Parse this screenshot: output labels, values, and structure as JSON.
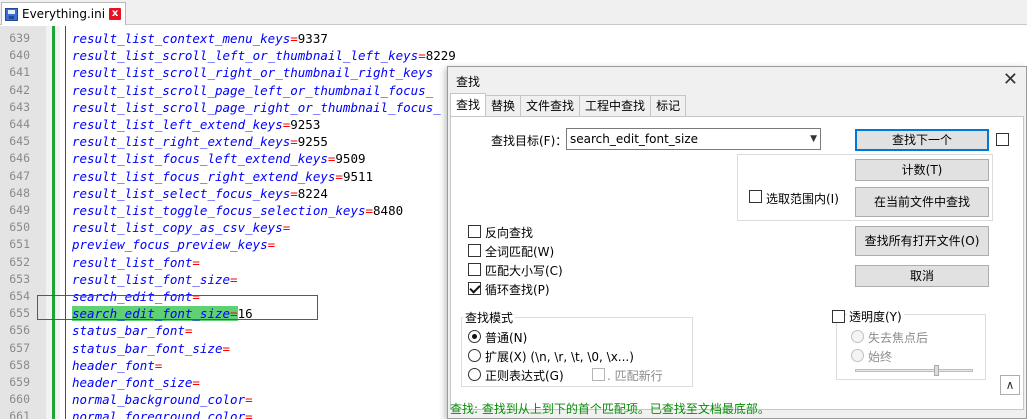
{
  "tab": {
    "label": "Everything.ini",
    "close": "x"
  },
  "editor": {
    "lines": [
      {
        "num": "639",
        "key": "result_list_context_menu_keys",
        "eq": "=",
        "val": "9337"
      },
      {
        "num": "640",
        "key": "result_list_scroll_left_or_thumbnail_left_keys",
        "eq": "=",
        "val": "8229"
      },
      {
        "num": "641",
        "key": "result_list_scroll_right_or_thumbnail_right_keys",
        "eq": "",
        "val": ""
      },
      {
        "num": "642",
        "key": "result_list_scroll_page_left_or_thumbnail_focus_",
        "eq": "",
        "val": ""
      },
      {
        "num": "643",
        "key": "result_list_scroll_page_right_or_thumbnail_focus_",
        "eq": "",
        "val": ""
      },
      {
        "num": "644",
        "key": "result_list_left_extend_keys",
        "eq": "=",
        "val": "9253"
      },
      {
        "num": "645",
        "key": "result_list_right_extend_keys",
        "eq": "=",
        "val": "9255"
      },
      {
        "num": "646",
        "key": "result_list_focus_left_extend_keys",
        "eq": "=",
        "val": "9509"
      },
      {
        "num": "647",
        "key": "result_list_focus_right_extend_keys",
        "eq": "=",
        "val": "9511"
      },
      {
        "num": "648",
        "key": "result_list_select_focus_keys",
        "eq": "=",
        "val": "8224"
      },
      {
        "num": "649",
        "key": "result_list_toggle_focus_selection_keys",
        "eq": "=",
        "val": "8480"
      },
      {
        "num": "650",
        "key": "result_list_copy_as_csv_keys",
        "eq": "=",
        "val": ""
      },
      {
        "num": "651",
        "key": "preview_focus_preview_keys",
        "eq": "=",
        "val": ""
      },
      {
        "num": "652",
        "key": "result_list_font",
        "eq": "=",
        "val": ""
      },
      {
        "num": "653",
        "key": "result_list_font_size",
        "eq": "=",
        "val": ""
      },
      {
        "num": "654",
        "key": "search_edit_font",
        "eq": "=",
        "val": ""
      },
      {
        "num": "655",
        "key": "search_edit_font_size",
        "eq": "=",
        "val": "16",
        "highlight": true
      },
      {
        "num": "656",
        "key": "status_bar_font",
        "eq": "=",
        "val": ""
      },
      {
        "num": "657",
        "key": "status_bar_font_size",
        "eq": "=",
        "val": ""
      },
      {
        "num": "658",
        "key": "header_font",
        "eq": "=",
        "val": ""
      },
      {
        "num": "659",
        "key": "header_font_size",
        "eq": "=",
        "val": ""
      },
      {
        "num": "660",
        "key": "normal_background_color",
        "eq": "=",
        "val": ""
      },
      {
        "num": "661",
        "key": "normal_foreground_color",
        "eq": "=",
        "val": ""
      }
    ]
  },
  "dialog": {
    "title": "查找",
    "close": "✕",
    "tabs": [
      "查找",
      "替换",
      "文件查找",
      "工程中查找",
      "标记"
    ],
    "find_label": "查找目标(F)：",
    "find_value": "search_edit_font_size",
    "combo_arrow": "▼",
    "buttons": {
      "find_next": "查找下一个",
      "count": "计数(T)",
      "find_in_current": "在当前文件中查找",
      "find_in_all_open": "查找所有打开文件(O)",
      "cancel": "取消"
    },
    "in_selection": "选取范围内(I)",
    "options": [
      {
        "label": "反向查找",
        "checked": false
      },
      {
        "label": "全词匹配(W)",
        "checked": false
      },
      {
        "label": "匹配大小写(C)",
        "checked": false
      },
      {
        "label": "循环查找(P)",
        "checked": true
      }
    ],
    "mode": {
      "title": "查找模式",
      "normal": "普通(N)",
      "extended": "扩展(X) (\\n, \\r, \\t, \\0, \\x...)",
      "regex": "正则表达式(G)",
      "dot_newline": ". 匹配新行",
      "selected": "normal"
    },
    "transparency": {
      "title": "透明度(Y)",
      "on_lose_focus": "失去焦点后",
      "always": "始终",
      "slider_level": 0.7
    },
    "collapse": "∧",
    "status": "查找: 查找到从上到下的首个匹配项。已查找至文档最底部。"
  },
  "colors": {
    "key": "#0000ff",
    "equals": "#ff0000",
    "match_highlight": "#5fd073",
    "status_text": "#0a8a0a",
    "change_bar": "#1fa535"
  }
}
